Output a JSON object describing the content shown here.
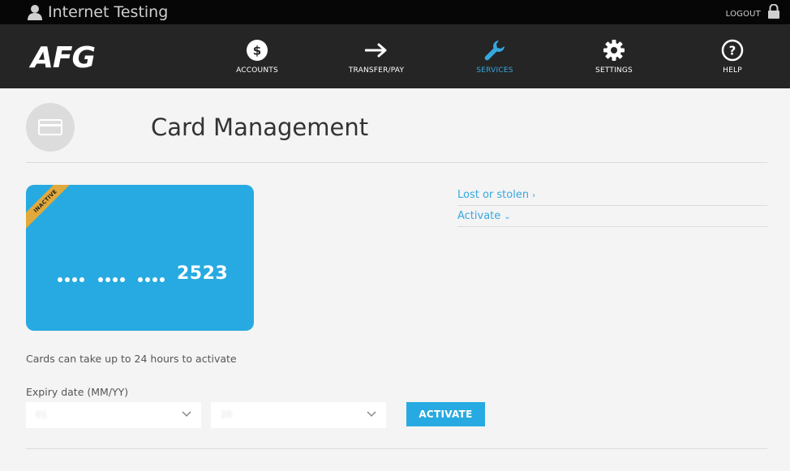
{
  "topbar": {
    "site_title": "Internet Testing",
    "logout_label": "LOGOUT"
  },
  "nav": {
    "logo": "AFG",
    "items": [
      {
        "label": "ACCOUNTS",
        "icon": "dollar-icon"
      },
      {
        "label": "TRANSFER/PAY",
        "icon": "arrow-right-icon"
      },
      {
        "label": "SERVICES",
        "icon": "wrench-icon",
        "active": true
      },
      {
        "label": "SETTINGS",
        "icon": "gear-icon"
      },
      {
        "label": "HELP",
        "icon": "question-icon"
      }
    ],
    "active_color": "#36a8e0"
  },
  "page": {
    "title": "Card Management",
    "icon": "credit-card-icon"
  },
  "card": {
    "status": "INACTIVE",
    "masked_groups": [
      "••••",
      "••••",
      "••••"
    ],
    "last4": "2523",
    "color": "#27aae1",
    "ribbon_color": "#e2a93b"
  },
  "side_links": [
    {
      "label": "Lost or stolen",
      "chevron": "›"
    },
    {
      "label": "Activate",
      "chevron": "⌄"
    }
  ],
  "note": "Cards can take up to 24 hours to activate",
  "expiry": {
    "label": "Expiry date (MM/YY)",
    "month_value": "01",
    "year_value": "20"
  },
  "activate_button": "ACTIVATE"
}
